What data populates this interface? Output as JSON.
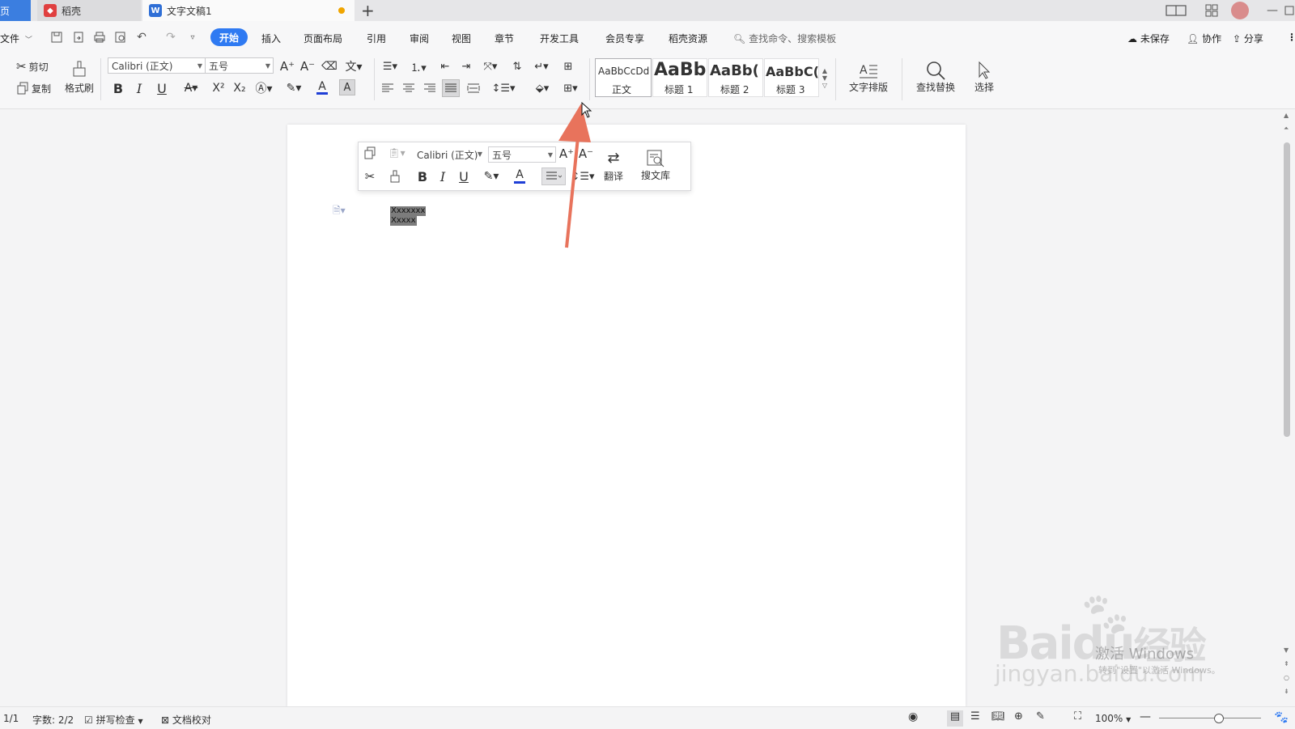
{
  "titlebar": {
    "tabs": [
      {
        "label": "页"
      },
      {
        "label": "稻壳"
      },
      {
        "label": "文字文稿1"
      }
    ],
    "new_tab": "+",
    "window_label": "1"
  },
  "menubar": {
    "file": "文件",
    "items": [
      "开始",
      "插入",
      "页面布局",
      "引用",
      "审阅",
      "视图",
      "章节",
      "开发工具",
      "会员专享",
      "稻壳资源"
    ],
    "search_placeholder": "查找命令、搜索模板",
    "unsaved": "未保存",
    "collab": "协作",
    "share": "分享"
  },
  "ribbon": {
    "cut": "剪切",
    "copy": "复制",
    "format_painter": "格式刷",
    "font_name": "Calibri (正文)",
    "font_size": "五号",
    "bold": "B",
    "italic": "I",
    "underline": "U",
    "superscript": "X²",
    "subscript": "X₂",
    "font_color_glyph": "A",
    "styles": [
      {
        "preview": "AaBbCcDd",
        "label": "正文"
      },
      {
        "preview": "AaBb",
        "label": "标题 1"
      },
      {
        "preview": "AaBb(",
        "label": "标题 2"
      },
      {
        "preview": "AaBbC(",
        "label": "标题 3"
      }
    ],
    "text_layout": "文字排版",
    "find_replace": "查找替换",
    "select": "选择"
  },
  "floatbar": {
    "font_name": "Calibri (正文)",
    "font_size": "五号",
    "bold": "B",
    "italic": "I",
    "underline": "U",
    "font_color_glyph": "A",
    "translate": "翻译",
    "search_library": "搜文库"
  },
  "document": {
    "lines": [
      "Xxxxxxx",
      "Xxxxx"
    ]
  },
  "statusbar": {
    "page": "1/1",
    "word_count": "字数: 2/2",
    "spell_check": "拼写检查",
    "doc_proof": "文档校对",
    "zoom": "100%"
  },
  "watermark": {
    "brand": "Bai",
    "brand_du": "du",
    "brand_cn": "经验",
    "activate": "激活 Windows",
    "activate_hint": "转到\"设置\"以激活 Windows。",
    "url": "jingyan.baidu.com"
  },
  "colors": {
    "accent": "#2f7af2",
    "arrow": "#e8735c",
    "font_color_bar": "#1f3fd6"
  }
}
